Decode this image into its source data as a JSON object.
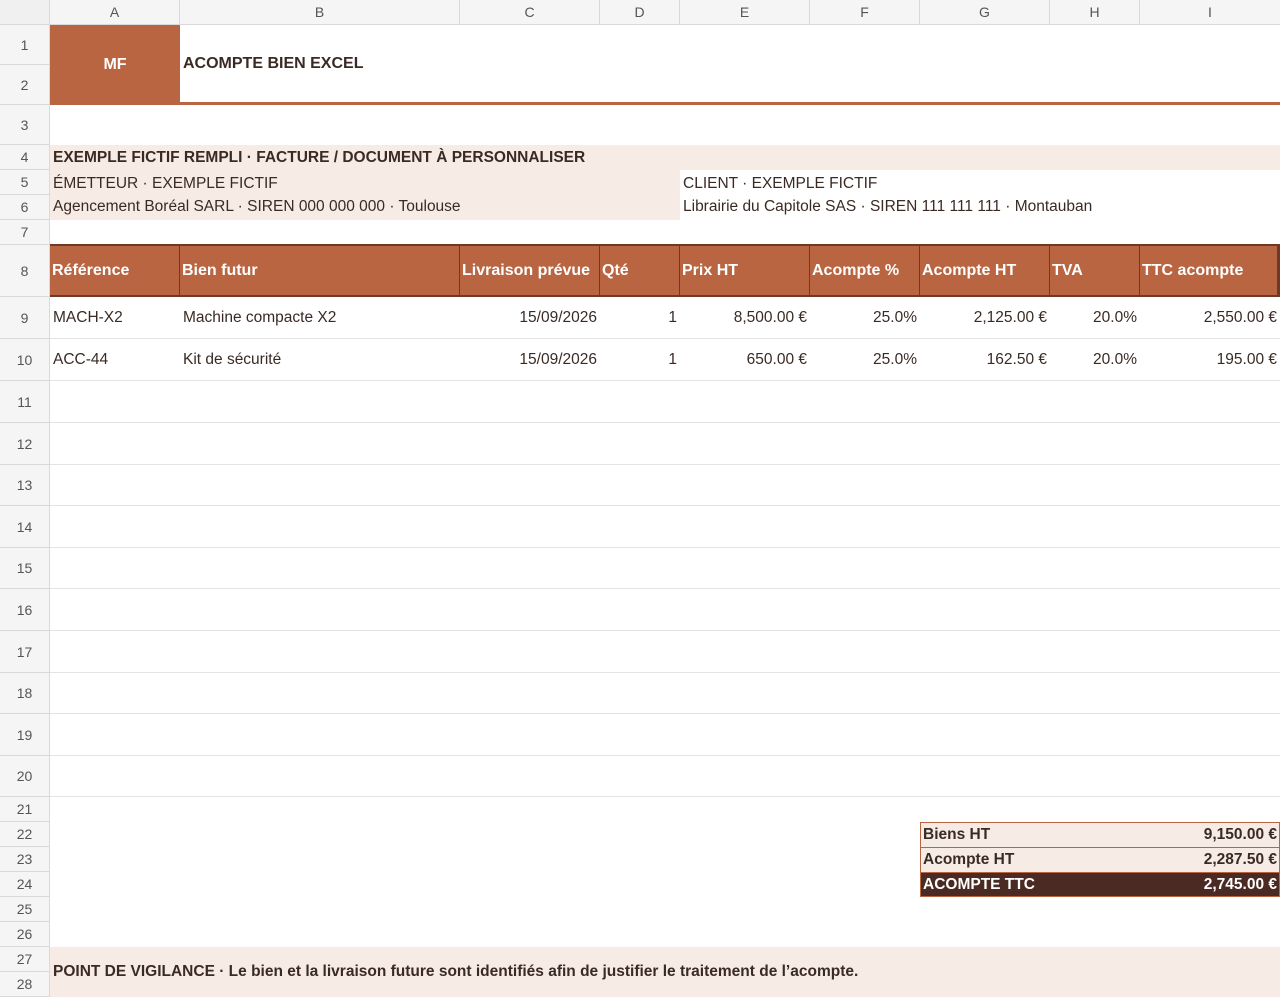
{
  "columns": [
    "A",
    "B",
    "C",
    "D",
    "E",
    "F",
    "G",
    "H",
    "I"
  ],
  "rows": [
    "1",
    "2",
    "3",
    "4",
    "5",
    "6",
    "7",
    "8",
    "9",
    "10",
    "11",
    "12",
    "13",
    "14",
    "15",
    "16",
    "17",
    "18",
    "19",
    "20",
    "21",
    "22",
    "23",
    "24",
    "25",
    "26",
    "27",
    "28"
  ],
  "logo": {
    "text": "MF"
  },
  "title": "ACOMPTE BIEN EXCEL",
  "banner": "EXEMPLE FICTIF REMPLI · FACTURE / DOCUMENT À PERSONNALISER",
  "emitter": {
    "label": "ÉMETTEUR · EXEMPLE FICTIF",
    "detail": "Agencement Boréal SARL · SIREN 000 000 000 · Toulouse"
  },
  "client": {
    "label": "CLIENT · EXEMPLE FICTIF",
    "detail": "Librairie du Capitole SAS · SIREN 111 111 111 · Montauban"
  },
  "table": {
    "headers": [
      "Référence",
      "Bien futur",
      "Livraison prévue",
      "Qté",
      "Prix HT",
      "Acompte %",
      "Acompte HT",
      "TVA",
      "TTC acompte"
    ],
    "rows": [
      [
        "MACH-X2",
        "Machine compacte X2",
        "15/09/2026",
        "1",
        "8,500.00 €",
        "25.0%",
        "2,125.00 €",
        "20.0%",
        "2,550.00 €"
      ],
      [
        "ACC-44",
        "Kit de sécurité",
        "15/09/2026",
        "1",
        "650.00 €",
        "25.0%",
        "162.50 €",
        "20.0%",
        "195.00 €"
      ]
    ]
  },
  "summary": [
    {
      "label": "Biens HT",
      "value": "9,150.00 €"
    },
    {
      "label": "Acompte HT",
      "value": "2,287.50 €"
    },
    {
      "label": "ACOMPTE TTC",
      "value": "2,745.00 €"
    }
  ],
  "note": "POINT DE VIGILANCE · Le bien et la livraison future sont identifiés afin de justifier le traitement de l’acompte.",
  "colors": {
    "accent": "#b96541",
    "light": "#f7ebe5",
    "dark": "#4a2a22"
  }
}
